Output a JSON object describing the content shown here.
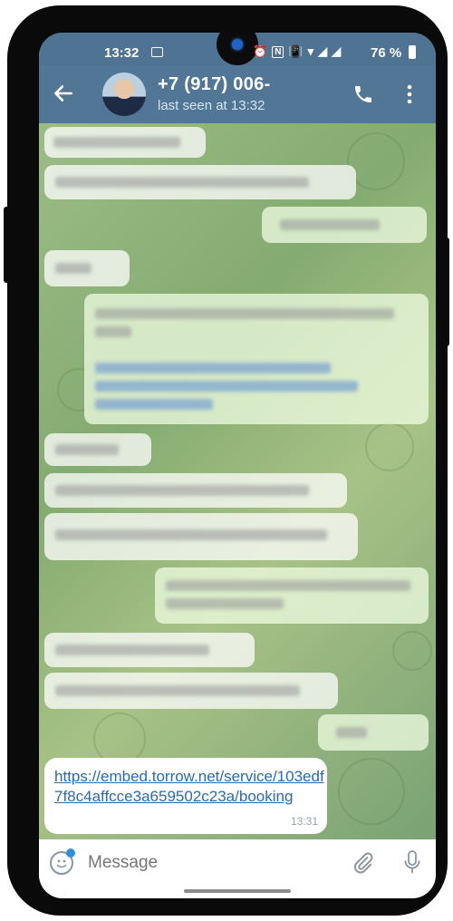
{
  "status_bar": {
    "time": "13:32",
    "battery": "76 %"
  },
  "header": {
    "contact_name": "+7 (917) 006-",
    "contact_status": "last seen at 13:32"
  },
  "last_message": {
    "link": "https://embed.torrow.net/service/103edf7f8c4affcce3a659502c23a/booking",
    "time": "13:31"
  },
  "composer": {
    "placeholder": "Message"
  },
  "colors": {
    "header": "#517696",
    "link": "#2b6aa8",
    "accent": "#2f8fe0"
  }
}
